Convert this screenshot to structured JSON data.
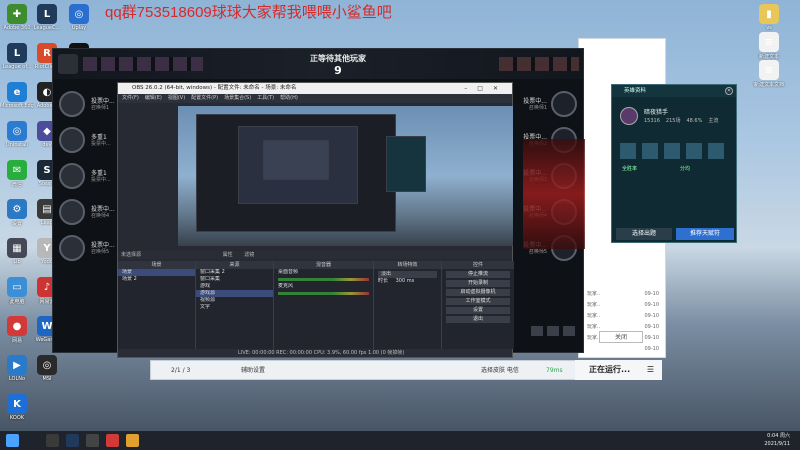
{
  "overlay_title": "qq群753518609球球大家帮我喂喂小鲨鱼吧",
  "desktop_left": [
    {
      "label": "Adobe 360",
      "color": "#3d8c2e",
      "glyph": "✚"
    },
    {
      "label": "League of...",
      "color": "#1f3a5a",
      "glyph": "L"
    },
    {
      "label": "Microsoft Edge",
      "color": "#1f7fd4",
      "glyph": "e"
    },
    {
      "label": "UnInstall",
      "color": "#2b7bd0",
      "glyph": "◎"
    },
    {
      "label": "微信",
      "color": "#27ae3c",
      "glyph": "✉"
    },
    {
      "label": "设置",
      "color": "#2b78c5",
      "glyph": "⚙"
    },
    {
      "label": "Lib",
      "color": "#444a55",
      "glyph": "▦"
    },
    {
      "label": "此电脑",
      "color": "#3a8fd6",
      "glyph": "▭"
    },
    {
      "label": "网易",
      "color": "#d23a3a",
      "glyph": "●"
    },
    {
      "label": "LOLNo",
      "color": "#2a7ac9",
      "glyph": "▶"
    },
    {
      "label": "KOOK",
      "color": "#1c6fd6",
      "glyph": "K"
    }
  ],
  "desktop_col2": [
    {
      "label": "LeagueC...",
      "color": "#1f3a5a",
      "glyph": "L"
    },
    {
      "label": "RiotClient",
      "color": "#d94a2a",
      "glyph": "R"
    },
    {
      "label": "Adobe 3",
      "color": "#222",
      "glyph": "◐"
    },
    {
      "label": "dev",
      "color": "#4c4c9a",
      "glyph": "◆"
    },
    {
      "label": "Steam",
      "color": "#1b2838",
      "glyph": "S"
    },
    {
      "label": "Leap",
      "color": "#3a3a3a",
      "glyph": "▤"
    },
    {
      "label": "Yodo",
      "color": "#b8b8b8",
      "glyph": "Y"
    },
    {
      "label": "网易云",
      "color": "#c33",
      "glyph": "♪"
    },
    {
      "label": "WeGame",
      "color": "#1f66c2",
      "glyph": "W"
    },
    {
      "label": "MSI",
      "color": "#2a2a2a",
      "glyph": "◎"
    }
  ],
  "desktop_col3": [
    {
      "label": "Uplay",
      "color": "#2a6fd0",
      "glyph": "◎"
    },
    {
      "label": "QQ",
      "color": "#111",
      "glyph": "☻"
    }
  ],
  "desktop_right": [
    {
      "label": "vs",
      "color": "#e8c65a",
      "glyph": "▮"
    },
    {
      "label": "新建文本",
      "color": "#f2f2f2",
      "glyph": "≡"
    },
    {
      "label": "新建文本文档",
      "color": "#f2f2f2",
      "glyph": "≡"
    }
  ],
  "lol": {
    "status": "正等待其他玩家",
    "timer": "9",
    "players_left": [
      {
        "name": "投票中...",
        "sub": "召唤师1"
      },
      {
        "name": "多重1",
        "sub": "投票中..."
      },
      {
        "name": "多重1",
        "sub": "投票中..."
      },
      {
        "name": "投票中...",
        "sub": "召唤师4"
      },
      {
        "name": "投票中...",
        "sub": "召唤师5"
      }
    ],
    "players_right": [
      {
        "name": "投票中...",
        "sub": "召唤师1"
      },
      {
        "name": "投票中...",
        "sub": "召唤师2"
      },
      {
        "name": "投票中...",
        "sub": "召唤师3"
      },
      {
        "name": "投票中...",
        "sub": "召唤师4"
      },
      {
        "name": "投票中...",
        "sub": "召唤师5"
      }
    ]
  },
  "obs": {
    "title": "OBS 26.0.2 (64-bit, windows) - 配置文件: 未命名 - 场景: 未命名",
    "menu": [
      "文件(F)",
      "编辑(E)",
      "视图(V)",
      "配置文件(P)",
      "场景集合(S)",
      "工具(T)",
      "帮助(H)"
    ],
    "statusline": "未选择源",
    "status_props": "属性",
    "status_filters": "滤镜",
    "docks": {
      "scenes_title": "场景",
      "scenes": [
        "场景",
        "场景 2"
      ],
      "sources_title": "来源",
      "sources": [
        "窗口采集 2",
        "窗口采集",
        "游戏",
        "游戏源",
        "视频源",
        "文字"
      ],
      "mixer_title": "混音器",
      "mixer": [
        "桌面音频",
        "麦克风"
      ],
      "transitions_title": "转场特效",
      "transition_value": "淡出",
      "duration_label": "时长",
      "duration_value": "300 ms",
      "controls_title": "控件",
      "controls": [
        "停止推流",
        "开始录制",
        "启动虚拟摄像机",
        "工作室模式",
        "设置",
        "退出"
      ]
    },
    "footer": "LIVE: 00:00:00   REC: 00:00:00   CPU: 3.9%, 60.00 fps   1.00 (0 帧掉帧)"
  },
  "client_bar": {
    "left_text": "2/1 / 3",
    "settings": "辅助设置",
    "status": "选择皮肤 电信",
    "ping": "79ms",
    "running": "正在运行..."
  },
  "client_list": [
    {
      "name": "玩家..",
      "date": "09-10"
    },
    {
      "name": "玩家..",
      "date": "09-10"
    },
    {
      "name": "玩家..",
      "date": "09-10"
    },
    {
      "name": "玩家..",
      "date": "09-10"
    },
    {
      "name": "玩家..",
      "date": "09-10"
    },
    {
      "name": "",
      "date": "09-10"
    }
  ],
  "client_close": "关闭",
  "champ": {
    "title": "英雄资料",
    "name": "暗夜猎手",
    "stats": [
      "15316",
      "215场",
      "48.6%",
      "主流"
    ],
    "left_label": "全胜率",
    "right_label": "分均",
    "btn_left": "选择出题",
    "btn_right": "推荐天赋符"
  },
  "clock": {
    "time": "0:04 周六",
    "date": "2021/9/11"
  },
  "colors": {
    "lol_bg": "#0e1116",
    "obs_bg": "#272a33",
    "accent_red": "#d62a2a",
    "champ_bg": "#0f2a33",
    "btn_blue": "#2f6fd0"
  }
}
